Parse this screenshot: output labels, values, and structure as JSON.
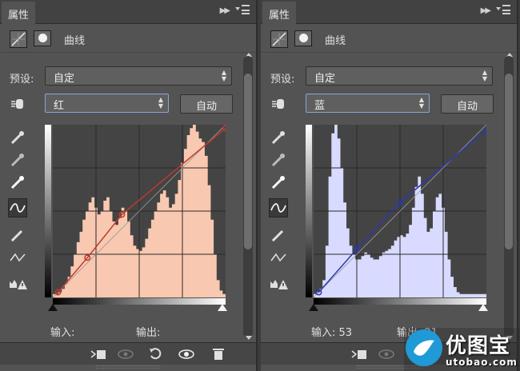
{
  "panels": [
    {
      "tab_label": "属性",
      "adjustment_label": "曲线",
      "preset_label": "预设:",
      "preset_value": "自定",
      "channel_value": "红",
      "auto_label": "自动",
      "input_label": "输入:",
      "input_value": "",
      "output_label": "输出:",
      "output_value": "",
      "histogram_color": "#f9c8b0",
      "curve_color": "#c0392b",
      "curve_points": [
        [
          0.03,
          0.03
        ],
        [
          0.2,
          0.23
        ],
        [
          0.4,
          0.48
        ],
        [
          1.0,
          0.98
        ]
      ],
      "histogram": [
        0.02,
        0.02,
        0.03,
        0.05,
        0.08,
        0.12,
        0.18,
        0.25,
        0.32,
        0.38,
        0.45,
        0.5,
        0.55,
        0.58,
        0.52,
        0.48,
        0.5,
        0.56,
        0.58,
        0.5,
        0.44,
        0.42,
        0.46,
        0.52,
        0.5,
        0.44,
        0.36,
        0.3,
        0.28,
        0.27,
        0.29,
        0.34,
        0.4,
        0.45,
        0.5,
        0.55,
        0.6,
        0.62,
        0.58,
        0.52,
        0.54,
        0.6,
        0.68,
        0.78,
        0.86,
        0.94,
        0.98,
        1.0,
        0.96,
        0.92,
        0.9,
        0.82,
        0.65,
        0.45,
        0.25,
        0.1,
        0.04,
        0.02
      ]
    },
    {
      "tab_label": "属性",
      "adjustment_label": "曲线",
      "preset_label": "预设:",
      "preset_value": "自定",
      "channel_value": "蓝",
      "auto_label": "自动",
      "input_label": "输入:",
      "input_value": "53",
      "output_label": "输出:",
      "output_value": "21",
      "histogram_color": "#d8dbff",
      "curve_color": "#2e3aa6",
      "curve_points": [
        [
          0.03,
          0.03
        ],
        [
          0.25,
          0.28
        ],
        [
          0.5,
          0.55
        ],
        [
          1.0,
          0.97
        ]
      ],
      "histogram": [
        0.02,
        0.03,
        0.05,
        0.1,
        0.3,
        0.7,
        0.95,
        1.0,
        0.92,
        0.75,
        0.55,
        0.4,
        0.3,
        0.25,
        0.22,
        0.22,
        0.24,
        0.26,
        0.25,
        0.23,
        0.22,
        0.22,
        0.24,
        0.26,
        0.27,
        0.28,
        0.3,
        0.33,
        0.35,
        0.36,
        0.35,
        0.37,
        0.42,
        0.52,
        0.64,
        0.7,
        0.6,
        0.46,
        0.38,
        0.4,
        0.5,
        0.58,
        0.6,
        0.52,
        0.38,
        0.22,
        0.12,
        0.06,
        0.03,
        0.02,
        0.02,
        0.02,
        0.02,
        0.02,
        0.02,
        0.02,
        0.02,
        0.02
      ]
    }
  ],
  "watermark": {
    "brand": "优图宝",
    "url": "utobao.com"
  }
}
